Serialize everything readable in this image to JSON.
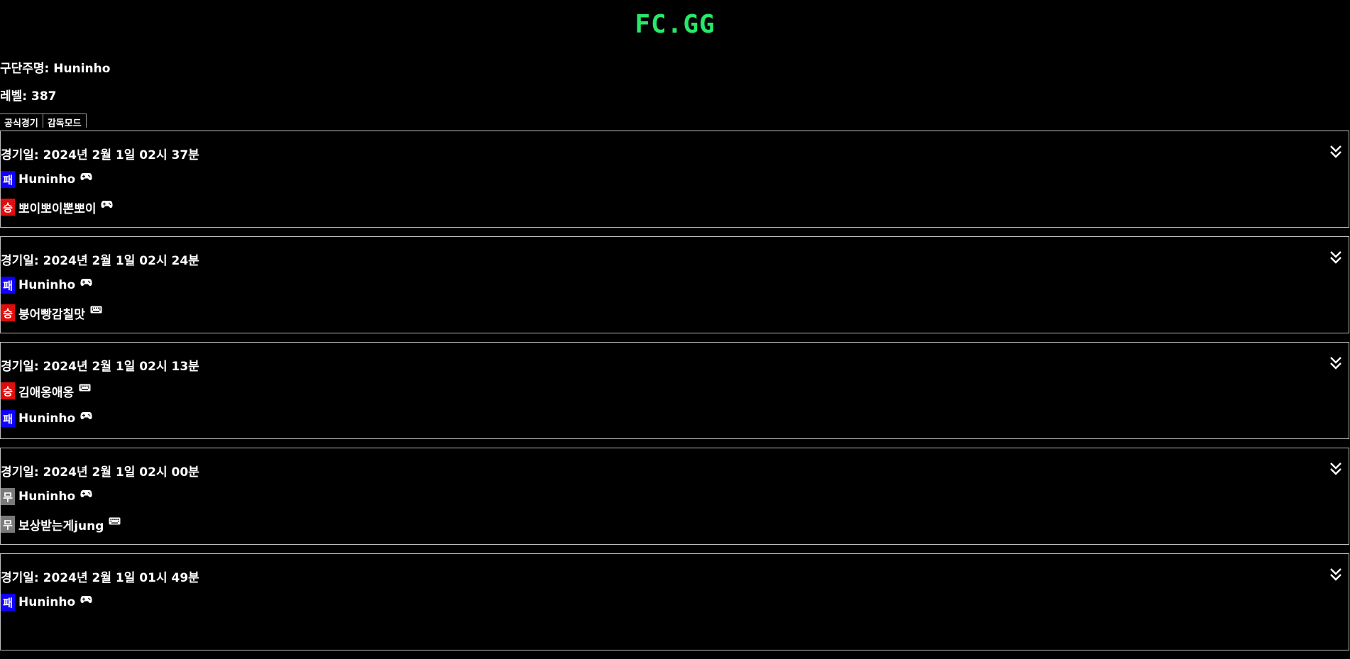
{
  "header": {
    "logo": "FC.GG"
  },
  "profile": {
    "manager_label": "구단주명: Huninho",
    "level_label": "레벨: 387"
  },
  "tabs": [
    {
      "label": "공식경기"
    },
    {
      "label": "감독모드"
    }
  ],
  "colors": {
    "win": "#e10d0d",
    "loss": "#1000ff",
    "draw": "#7a7a7a",
    "logo": "#27e86a"
  },
  "matches": [
    {
      "date": "경기일: 2024년 2월 1일 02시 37분",
      "players": [
        {
          "result": "패",
          "name": "Huninho",
          "device": "gamepad-icon"
        },
        {
          "result": "승",
          "name": "뽀이뽀이뽄뽀이",
          "device": "gamepad-icon"
        }
      ]
    },
    {
      "date": "경기일: 2024년 2월 1일 02시 24분",
      "players": [
        {
          "result": "패",
          "name": "Huninho",
          "device": "gamepad-icon"
        },
        {
          "result": "승",
          "name": "붕어빵감칠맛",
          "device": "keyboard-icon"
        }
      ]
    },
    {
      "date": "경기일: 2024년 2월 1일 02시 13분",
      "players": [
        {
          "result": "승",
          "name": "김애옹애옹",
          "device": "keyboard-icon"
        },
        {
          "result": "패",
          "name": "Huninho",
          "device": "gamepad-icon"
        }
      ]
    },
    {
      "date": "경기일: 2024년 2월 1일 02시 00분",
      "players": [
        {
          "result": "무",
          "name": "Huninho",
          "device": "gamepad-icon"
        },
        {
          "result": "무",
          "name": "보상받는게jung",
          "device": "keyboard-icon"
        }
      ]
    },
    {
      "date": "경기일: 2024년 2월 1일 01시 49분",
      "players": [
        {
          "result": "패",
          "name": "Huninho",
          "device": "gamepad-icon"
        }
      ]
    }
  ]
}
